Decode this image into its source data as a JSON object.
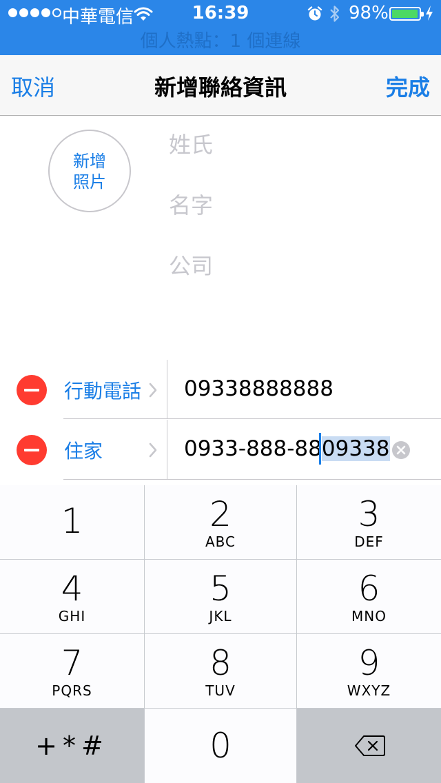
{
  "status_bar": {
    "carrier": "中華電信",
    "time": "16:39",
    "battery_percent": "98%",
    "battery_level": 0.98,
    "signal_bars_filled": 4,
    "signal_bars_total": 5
  },
  "hotspot_banner": "個人熱點：1 個連線",
  "nav": {
    "cancel_label": "取消",
    "title": "新增聯絡資訊",
    "done_label": "完成"
  },
  "photo": {
    "line1": "新增",
    "line2": "照片"
  },
  "name_fields": {
    "last_name_placeholder": "姓氏",
    "first_name_placeholder": "名字",
    "company_placeholder": "公司"
  },
  "phones": [
    {
      "label": "行動電話",
      "value": "09338888888"
    },
    {
      "label": "住家",
      "value_unselected": "0933-888-88",
      "value_selected": "09338"
    }
  ],
  "keypad": {
    "keys": [
      {
        "digit": "1",
        "letters": ""
      },
      {
        "digit": "2",
        "letters": "ABC"
      },
      {
        "digit": "3",
        "letters": "DEF"
      },
      {
        "digit": "4",
        "letters": "GHI"
      },
      {
        "digit": "5",
        "letters": "JKL"
      },
      {
        "digit": "6",
        "letters": "MNO"
      },
      {
        "digit": "7",
        "letters": "PQRS"
      },
      {
        "digit": "8",
        "letters": "TUV"
      },
      {
        "digit": "9",
        "letters": "WXYZ"
      }
    ],
    "symbols_label": "+*#",
    "zero": "0"
  },
  "colors": {
    "accent": "#1a7ee6",
    "status_bar": "#2b86e8",
    "delete": "#ff3b30",
    "battery": "#4cd964"
  }
}
